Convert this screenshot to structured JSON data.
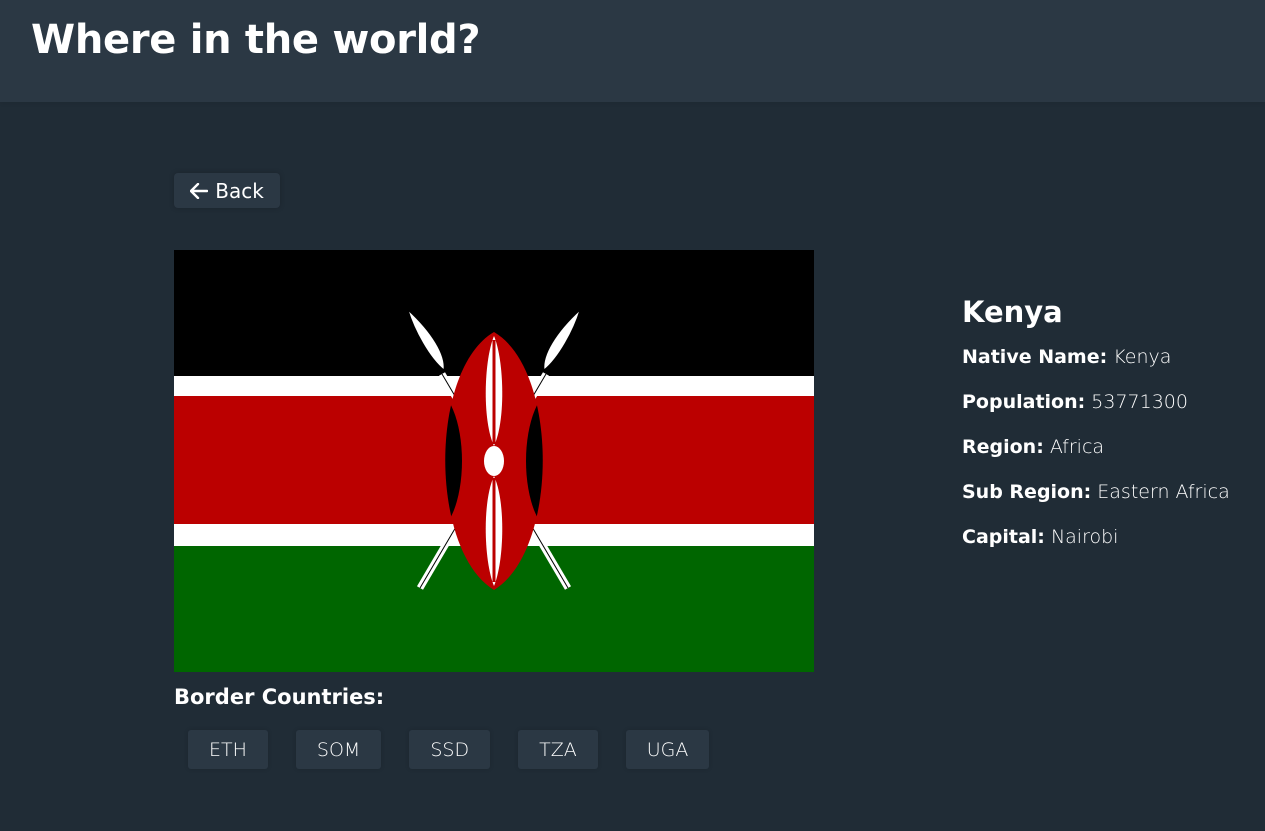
{
  "header": {
    "title": "Where in the world?"
  },
  "back_button": {
    "label": "Back",
    "icon": "arrow-left-icon"
  },
  "flag": {
    "icon": "kenya-flag",
    "colors": {
      "black": "#000000",
      "red": "#bb0000",
      "green": "#006600",
      "white": "#ffffff"
    }
  },
  "country": {
    "name": "Kenya",
    "fields": [
      {
        "key": "Native Name:",
        "value": "Kenya"
      },
      {
        "key": "Population:",
        "value": "53771300"
      },
      {
        "key": "Region:",
        "value": "Africa"
      },
      {
        "key": "Sub Region:",
        "value": "Eastern Africa"
      },
      {
        "key": "Capital:",
        "value": "Nairobi"
      }
    ]
  },
  "borders": {
    "title": "Border Countries:",
    "countries": [
      "ETH",
      "SOM",
      "SSD",
      "TZA",
      "UGA"
    ]
  },
  "theme": {
    "background": "#202c36",
    "surface": "#2b3844",
    "text": "#ffffff"
  }
}
